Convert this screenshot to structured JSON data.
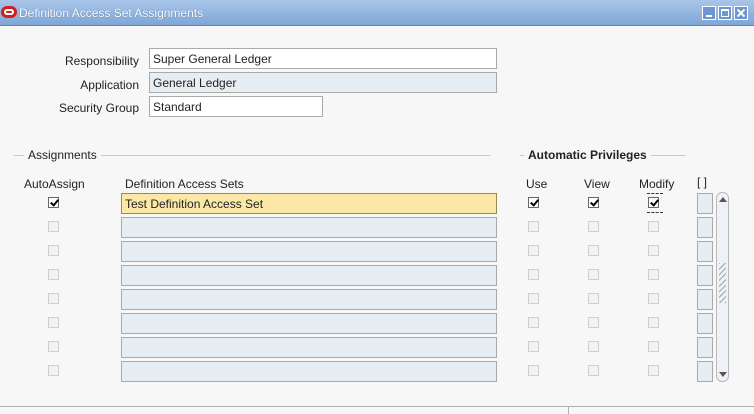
{
  "window": {
    "title": "Definition Access Set Assignments",
    "icon": "oracle-icon",
    "controls": [
      "minimize-icon",
      "maximize-icon",
      "close-icon"
    ]
  },
  "header_form": {
    "responsibility": {
      "label": "Responsibility",
      "value": "Super General Ledger"
    },
    "application": {
      "label": "Application",
      "value": "General Ledger"
    },
    "security_group": {
      "label": "Security Group",
      "value": "Standard"
    }
  },
  "assignments": {
    "section_title": "Assignments",
    "privileges_title": "Automatic Privileges",
    "columns": {
      "autoassign": "AutoAssign",
      "definition_access_sets": "Definition Access Sets",
      "use": "Use",
      "view": "View",
      "modify": "Modify",
      "desc_flex": "[ ]"
    },
    "rows": [
      {
        "autoassign": true,
        "definition_access_set": "Test Definition Access Set",
        "use": true,
        "view": true,
        "modify": true
      },
      {
        "autoassign": false,
        "definition_access_set": "",
        "use": false,
        "view": false,
        "modify": false
      },
      {
        "autoassign": false,
        "definition_access_set": "",
        "use": false,
        "view": false,
        "modify": false
      },
      {
        "autoassign": false,
        "definition_access_set": "",
        "use": false,
        "view": false,
        "modify": false
      },
      {
        "autoassign": false,
        "definition_access_set": "",
        "use": false,
        "view": false,
        "modify": false
      },
      {
        "autoassign": false,
        "definition_access_set": "",
        "use": false,
        "view": false,
        "modify": false
      },
      {
        "autoassign": false,
        "definition_access_set": "",
        "use": false,
        "view": false,
        "modify": false
      },
      {
        "autoassign": false,
        "definition_access_set": "",
        "use": false,
        "view": false,
        "modify": false
      }
    ]
  },
  "colors": {
    "titlebar": "#7fa6d6",
    "active_row": "#fbe8a6",
    "readonly_field": "#e6edf3"
  }
}
